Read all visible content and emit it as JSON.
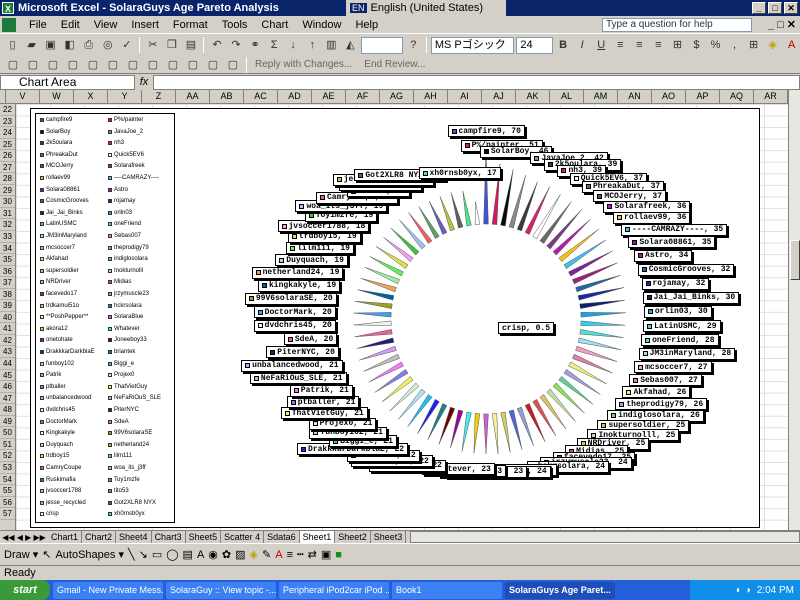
{
  "window": {
    "title": "Microsoft Excel - SolaraGuys Age Pareto Analysis",
    "language": "English (United States)",
    "lang_code": "EN"
  },
  "menu": {
    "items": [
      "File",
      "Edit",
      "View",
      "Insert",
      "Format",
      "Tools",
      "Chart",
      "Window",
      "Help"
    ],
    "ask_placeholder": "Type a question for help"
  },
  "toolbar": {
    "font": "MS Pゴシック",
    "size": "24",
    "bold": "B",
    "italic": "I",
    "underline": "U",
    "reply": "Reply with Changes...",
    "end_review": "End Review..."
  },
  "formula_bar": {
    "name_box": "Chart Area",
    "fx": "fx"
  },
  "columns": [
    "V",
    "W",
    "X",
    "Y",
    "Z",
    "AA",
    "AB",
    "AC",
    "AD",
    "AE",
    "AF",
    "AG",
    "AH",
    "AI",
    "AJ",
    "AK",
    "AL",
    "AM",
    "AN",
    "AO",
    "AP",
    "AQ",
    "AR"
  ],
  "rows": [
    "22",
    "23",
    "24",
    "25",
    "26",
    "27",
    "28",
    "29",
    "30",
    "31",
    "32",
    "33",
    "34",
    "35",
    "36",
    "37",
    "38",
    "39",
    "40",
    "41",
    "42",
    "43",
    "44",
    "45",
    "46",
    "47",
    "48",
    "49",
    "50",
    "51",
    "52",
    "53",
    "54",
    "55",
    "56",
    "57"
  ],
  "legend": {
    "left": [
      "campfire9",
      "SolarBoy",
      "2k5oulara",
      "PhreakaDut",
      "MCOJerry",
      "rollaev99",
      "Solara08861",
      "CosmicGrooves",
      "Jai_Jai_Binks",
      "LatinUSMC",
      "JM3inMaryland",
      "mcsoccer7",
      "Akfahad",
      "supersoldier",
      "NRDriver",
      "facevedo17",
      "trdkamui51o",
      "**PoshPepper**",
      "akora12",
      "onetohate",
      "DrakkkarDarkblaE",
      "funboy102",
      "Patrik",
      "ptballer",
      "unbalancedwood",
      "dvdchris45",
      "DoctorMark",
      "Kingkakyle",
      "Duyquach",
      "trdboy15",
      "CamryCoupe",
      "Ruskimafia",
      "jvsoccer1788",
      "jesse_recycled",
      "crisp"
    ],
    "right": [
      "P%/painter",
      "JavaJoe_2",
      "nh3",
      "Quick5EV6",
      "Solarafreek",
      "----CAMRAZY----",
      "Astro",
      "rojamay",
      "orlin03",
      "oneFriend",
      "Sebas007",
      "theprodigy79",
      "indiglosolara",
      "Inokturnolll",
      "Midias",
      "jrzymuscle23",
      "hckrsolara",
      "SolaraBlue",
      "Whatever",
      "Joneeboy33",
      "briantek",
      "Biggi_e",
      "Projex0",
      "ThatVietGuy",
      "NeFaRiOuS_SLE",
      "PiterNYC",
      "SdeA",
      "99V6solaraSE",
      "netherland24",
      "lilm111",
      "woa_its_j3ff",
      "Toy1mzfe",
      "tito53",
      "Got2XLR8 NYX",
      "xh0rnsb0yx"
    ]
  },
  "chart_data": {
    "type": "pie",
    "title": "",
    "center_label": "crisp, 0.5",
    "slices": [
      {
        "name": "campfire9",
        "value": 70,
        "color": "#3a55d6"
      },
      {
        "name": "P%/painter",
        "value": 51,
        "color": "#d6185c"
      },
      {
        "name": "SolarBoy",
        "value": 46,
        "color": "#0a0a0a"
      },
      {
        "name": "JavaJoe_2",
        "value": 42,
        "color": "#8a8a8a"
      },
      {
        "name": "2k5oulara",
        "value": 39,
        "color": "#3a3a3a"
      },
      {
        "name": "nh3",
        "value": 39,
        "color": "#d8206c"
      },
      {
        "name": "Quick5EV6",
        "value": 37,
        "color": "#ffffff"
      },
      {
        "name": "PhreakaDut",
        "value": 37,
        "color": "#6a6a6a"
      },
      {
        "name": "MCOJerry",
        "value": 37,
        "color": "#7a3a8a"
      },
      {
        "name": "Solarafreek",
        "value": 36,
        "color": "#b020b0"
      },
      {
        "name": "rollaev99",
        "value": 36,
        "color": "#f0c020"
      },
      {
        "name": "----CAMRAZY----",
        "value": 35,
        "color": "#40c0f0"
      },
      {
        "name": "Solara08861",
        "value": 35,
        "color": "#8020a0"
      },
      {
        "name": "Astro",
        "value": 34,
        "color": "#a02080"
      },
      {
        "name": "CosmicGrooves",
        "value": 32,
        "color": "#206aa0"
      },
      {
        "name": "rojamay",
        "value": 32,
        "color": "#1a2aa0"
      },
      {
        "name": "Jai_Jai_Binks",
        "value": 30,
        "color": "#102070"
      },
      {
        "name": "orlin03",
        "value": 30,
        "color": "#20a0e0"
      },
      {
        "name": "LatinUSMC",
        "value": 29,
        "color": "#30d0f0"
      },
      {
        "name": "oneFriend",
        "value": 28,
        "color": "#50e0d0"
      },
      {
        "name": "JM3inMaryland",
        "value": 28,
        "color": "#a0e0f0"
      },
      {
        "name": "mcsoccer7",
        "value": 27,
        "color": "#f0a0c0"
      },
      {
        "name": "Sebas007",
        "value": 27,
        "color": "#e080a0"
      },
      {
        "name": "Akfahad",
        "value": 26,
        "color": "#f0f080"
      },
      {
        "name": "theprodigy79",
        "value": 26,
        "color": "#a0a0e0"
      },
      {
        "name": "indiglosolara",
        "value": 26,
        "color": "#60d0a0"
      },
      {
        "name": "supersoldier",
        "value": 25,
        "color": "#90e060"
      },
      {
        "name": "Inokturnolll",
        "value": 25,
        "color": "#c0e0a0"
      },
      {
        "name": "NRDriver",
        "value": 25,
        "color": "#e0c060"
      },
      {
        "name": "Midias",
        "value": 25,
        "color": "#e05050"
      },
      {
        "name": "facevedo17",
        "value": 25,
        "color": "#c02020"
      },
      {
        "name": "jrzymuscle23",
        "value": 24,
        "color": "#90a0d0"
      },
      {
        "name": "hckrsolara",
        "value": 24,
        "color": "#4a6ad0"
      },
      {
        "name": "trdkamui51o",
        "value": 24,
        "color": "#d0d060"
      },
      {
        "name": "**PoshPepper**",
        "value": 24,
        "color": "#f0f0a0"
      },
      {
        "name": "SolaraBlue",
        "value": 23,
        "color": "#d060d0"
      },
      {
        "name": "akora12",
        "value": 23,
        "color": "#f0d000"
      },
      {
        "name": "Whatever",
        "value": 23,
        "color": "#40f0f0"
      },
      {
        "name": "onetohate",
        "value": 22,
        "color": "#a000a0"
      },
      {
        "name": "Joneeboy33",
        "value": 22,
        "color": "#700000"
      },
      {
        "name": "briantek",
        "value": 22,
        "color": "#208080"
      },
      {
        "name": "DrakkkarDarkblaE",
        "value": 22,
        "color": "#2020f0"
      },
      {
        "name": "Biggi_e",
        "value": 21,
        "color": "#20c0f0"
      },
      {
        "name": "funboy102",
        "value": 21,
        "color": "#b0e0f0"
      },
      {
        "name": "Projex0",
        "value": 21,
        "color": "#d0f0d0"
      },
      {
        "name": "ThatVietGuy",
        "value": 21,
        "color": "#f0f060"
      },
      {
        "name": "ptballer",
        "value": 21,
        "color": "#8080f0"
      },
      {
        "name": "Patrik",
        "value": 21,
        "color": "#f080f0"
      },
      {
        "name": "NeFaRiOuS_SLE",
        "value": 21,
        "color": "#c0c0c0"
      },
      {
        "name": "unbalancedwood",
        "value": 21,
        "color": "#d0a0f0"
      },
      {
        "name": "PiterNYC",
        "value": 20,
        "color": "#202080"
      },
      {
        "name": "SdeA",
        "value": 20,
        "color": "#f060a0"
      },
      {
        "name": "dvdchris45",
        "value": 20,
        "color": "#f0f0f0"
      },
      {
        "name": "DoctorMark",
        "value": 20,
        "color": "#40a0f0"
      },
      {
        "name": "99V6solaraSE",
        "value": 20,
        "color": "#a0a020"
      },
      {
        "name": "kingkakyle",
        "value": 19,
        "color": "#0060a0"
      },
      {
        "name": "netherland24",
        "value": 19,
        "color": "#f0a060"
      },
      {
        "name": "Duyquach",
        "value": 19,
        "color": "#a0f0a0"
      },
      {
        "name": "lilm111",
        "value": 19,
        "color": "#60f060"
      },
      {
        "name": "trdboy15",
        "value": 19,
        "color": "#e0e040"
      },
      {
        "name": "jvsoccer1788",
        "value": 18,
        "color": "#f0a0f0"
      },
      {
        "name": "Toy1mzfe",
        "value": 19,
        "color": "#40c040"
      },
      {
        "name": "woa_its_j3ff",
        "value": 19,
        "color": "#a0c0f0"
      },
      {
        "name": "CamryCoupe",
        "value": 19,
        "color": "#f06060"
      },
      {
        "name": "tito53",
        "value": 18,
        "color": "#60a060"
      },
      {
        "name": "Ruskimafia",
        "value": 18,
        "color": "#6060c0"
      },
      {
        "name": "jesse_recycled",
        "value": 18,
        "color": "#c0c040"
      },
      {
        "name": "Got2XLR8 NYX",
        "value": 18,
        "color": "#606060"
      },
      {
        "name": "xh0rnsb0yx",
        "value": 17,
        "color": "#40f080"
      },
      {
        "name": "crisp",
        "value": 0.5,
        "color": "#ffffff"
      }
    ]
  },
  "sheet_tabs": [
    "Chart1",
    "Chart2",
    "Sheet4",
    "Chart3",
    "Sheet5",
    "Scatter 4",
    "Sdata6",
    "Sheet1",
    "Sheet2",
    "Sheet3"
  ],
  "active_tab": "Sheet1",
  "drawbar": {
    "draw": "Draw ▾",
    "autoshapes": "AutoShapes ▾"
  },
  "status": "Ready",
  "taskbar": {
    "start": "start",
    "tasks": [
      "Gmail - New Private Mess...",
      "SolaraGuy :: View topic -...",
      "Peripheral iPod2car iPod ...",
      "Book1",
      "SolaraGuys Age Paret..."
    ],
    "time": "2:04 PM"
  }
}
